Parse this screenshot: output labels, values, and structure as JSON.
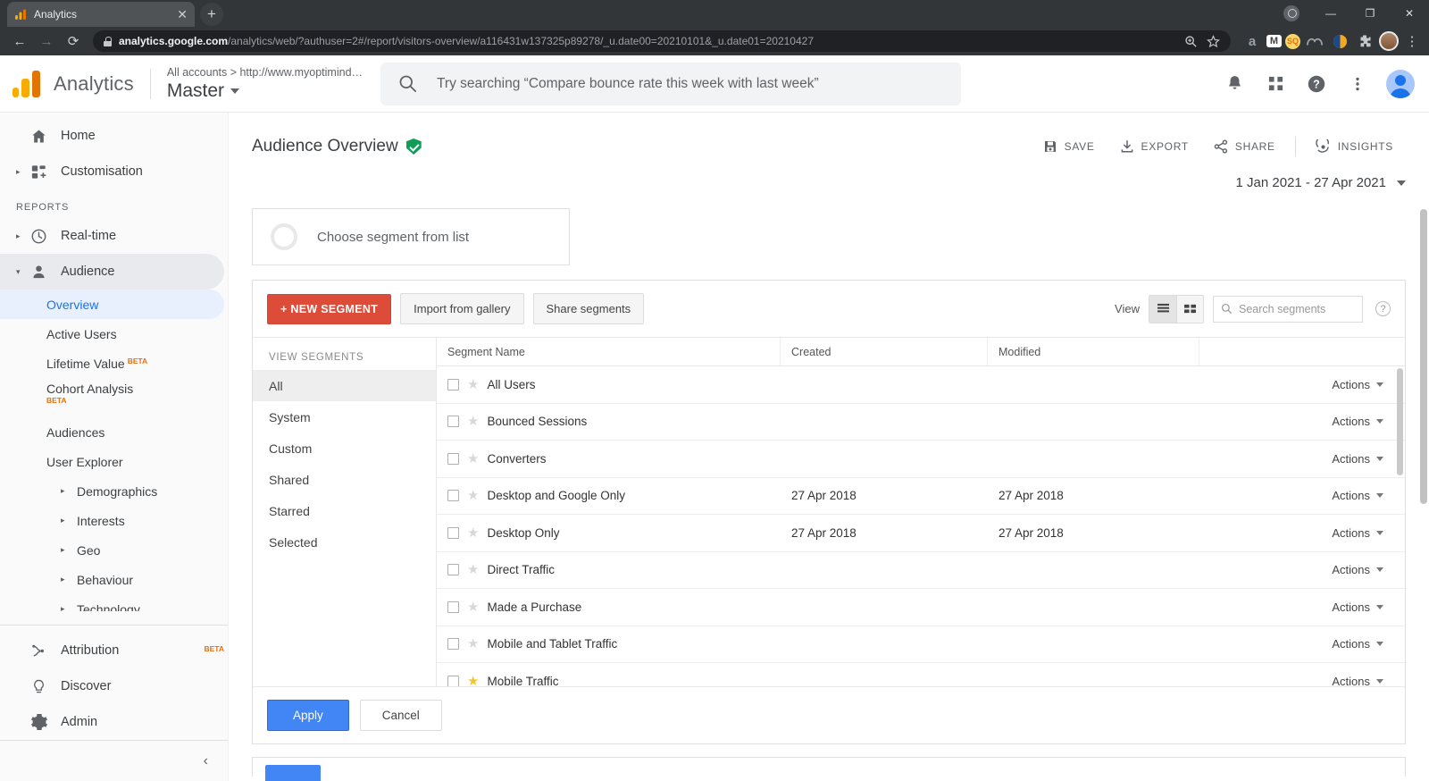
{
  "browser": {
    "tab": {
      "title": "Analytics",
      "favicon": "analytics-bars-icon",
      "close": "✕"
    },
    "new_tab_label": "+",
    "window": {
      "minimize": "—",
      "maximize": "❐",
      "close": "✕"
    },
    "nav": {
      "back": "←",
      "forward": "→",
      "reload": "⟳"
    },
    "url": {
      "domain": "analytics.google.com",
      "path": "/analytics/web/?authuser=2#/report/visitors-overview/a116431w137325p89278/_u.date00=20210101&_u.date01=20210427"
    },
    "omnibox_icons": [
      "zoom-icon",
      "bookmark-star-icon"
    ],
    "extensions": [
      "amazon-extension-icon",
      "gmail-extension-icon",
      "seo-extension-icon",
      "moz-extension-icon",
      "ghostery-extension-icon",
      "puzzle-extensions-icon"
    ],
    "profile": "profile-avatar",
    "menu": "⋮"
  },
  "ga_header": {
    "brand": "Analytics",
    "breadcrumb": "All accounts > http://www.myoptimind…",
    "account_name": "Master",
    "search_placeholder": "Try searching “Compare bounce rate this week with last week”",
    "icons": [
      "notifications-bell-icon",
      "apps-grid-icon",
      "help-icon",
      "more-vert-icon",
      "user-avatar"
    ]
  },
  "sidebar": {
    "top_items": [
      {
        "label": "Home",
        "icon": "home-icon",
        "arrow": false,
        "name": "home"
      },
      {
        "label": "Customisation",
        "icon": "customisation-icon",
        "arrow": true,
        "name": "customisation"
      }
    ],
    "section_label": "REPORTS",
    "reports": [
      {
        "label": "Real-time",
        "icon": "clock-icon",
        "arrow": true,
        "name": "real-time"
      },
      {
        "label": "Audience",
        "icon": "person-icon",
        "arrow": true,
        "name": "audience",
        "selected": true
      }
    ],
    "audience_sub": [
      {
        "label": "Overview",
        "active": true,
        "arrow": false,
        "beta": ""
      },
      {
        "label": "Active Users",
        "active": false,
        "arrow": false,
        "beta": ""
      },
      {
        "label": "Lifetime Value",
        "active": false,
        "arrow": false,
        "beta": "BETA"
      },
      {
        "label": "Cohort Analysis",
        "active": false,
        "arrow": false,
        "beta": "BETA"
      },
      {
        "label": "Audiences",
        "active": false,
        "arrow": false,
        "beta": ""
      },
      {
        "label": "User Explorer",
        "active": false,
        "arrow": false,
        "beta": ""
      },
      {
        "label": "Demographics",
        "active": false,
        "arrow": true,
        "beta": ""
      },
      {
        "label": "Interests",
        "active": false,
        "arrow": true,
        "beta": ""
      },
      {
        "label": "Geo",
        "active": false,
        "arrow": true,
        "beta": ""
      },
      {
        "label": "Behaviour",
        "active": false,
        "arrow": true,
        "beta": ""
      },
      {
        "label": "Technology",
        "active": false,
        "arrow": true,
        "beta": ""
      }
    ],
    "bottom_items": [
      {
        "label": "Attribution",
        "icon": "attribution-icon",
        "beta": "BETA",
        "name": "attribution"
      },
      {
        "label": "Discover",
        "icon": "lightbulb-icon",
        "beta": "",
        "name": "discover"
      },
      {
        "label": "Admin",
        "icon": "gear-icon",
        "beta": "",
        "name": "admin"
      }
    ],
    "collapse_icon": "‹"
  },
  "main": {
    "title": "Audience Overview",
    "verified_icon": "green-shield-check-icon",
    "actions": [
      {
        "label": "SAVE",
        "icon": "save-icon"
      },
      {
        "label": "EXPORT",
        "icon": "export-icon"
      },
      {
        "label": "SHARE",
        "icon": "share-icon"
      },
      {
        "label": "INSIGHTS",
        "icon": "insights-icon"
      }
    ],
    "date_range": "1 Jan 2021 - 27 Apr 2021",
    "segment_chooser": "Choose segment from list"
  },
  "segment_panel": {
    "buttons": {
      "new_segment": "+ NEW SEGMENT",
      "import_gallery": "Import from gallery",
      "share_segments": "Share segments"
    },
    "view_label": "View",
    "view_modes": [
      "list-view-icon",
      "grid-view-icon"
    ],
    "search_placeholder": "Search segments",
    "help_icon": "?",
    "filters_label": "VIEW SEGMENTS",
    "filters": [
      {
        "label": "All",
        "active": true
      },
      {
        "label": "System",
        "active": false
      },
      {
        "label": "Custom",
        "active": false
      },
      {
        "label": "Shared",
        "active": false
      },
      {
        "label": "Starred",
        "active": false
      },
      {
        "label": "Selected",
        "active": false
      }
    ],
    "columns": [
      "Segment Name",
      "Created",
      "Modified",
      ""
    ],
    "rows": [
      {
        "name": "All Users",
        "created": "",
        "modified": "",
        "actions": "Actions",
        "starred": false
      },
      {
        "name": "Bounced Sessions",
        "created": "",
        "modified": "",
        "actions": "Actions",
        "starred": false
      },
      {
        "name": "Converters",
        "created": "",
        "modified": "",
        "actions": "Actions",
        "starred": false
      },
      {
        "name": "Desktop and Google Only",
        "created": "27 Apr 2018",
        "modified": "27 Apr 2018",
        "actions": "Actions",
        "starred": false
      },
      {
        "name": "Desktop Only",
        "created": "27 Apr 2018",
        "modified": "27 Apr 2018",
        "actions": "Actions",
        "starred": false
      },
      {
        "name": "Direct Traffic",
        "created": "",
        "modified": "",
        "actions": "Actions",
        "starred": false
      },
      {
        "name": "Made a Purchase",
        "created": "",
        "modified": "",
        "actions": "Actions",
        "starred": false
      },
      {
        "name": "Mobile and Tablet Traffic",
        "created": "",
        "modified": "",
        "actions": "Actions",
        "starred": false
      },
      {
        "name": "Mobile Traffic",
        "created": "",
        "modified": "",
        "actions": "Actions",
        "starred": true
      }
    ],
    "footer": {
      "apply": "Apply",
      "cancel": "Cancel"
    }
  },
  "colors": {
    "ga_orange": "#f9ab00",
    "ga_orange_dark": "#e37400",
    "accent_blue": "#1a73e8",
    "apply_blue": "#4285f4",
    "new_segment_red": "#dd4b39",
    "beta_orange": "#e8710a",
    "verified_green": "#0f9d58",
    "star_gold": "#f4c430"
  }
}
